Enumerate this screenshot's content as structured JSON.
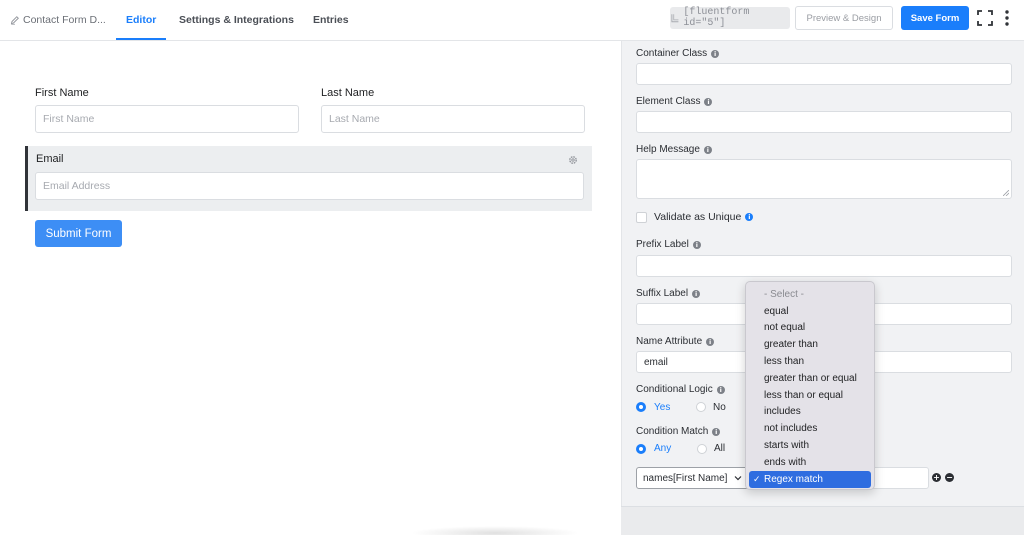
{
  "header": {
    "form_title": "Contact Form D...",
    "tabs": [
      {
        "label": "Editor",
        "active": true
      },
      {
        "label": "Settings & Integrations",
        "active": false
      },
      {
        "label": "Entries",
        "active": false
      }
    ],
    "shortcode": "[fluentform id=\"5\"]",
    "preview_label": "Preview & Design",
    "save_label": "Save Form",
    "accent_color": "#1a7efb"
  },
  "editor": {
    "first_name": {
      "label": "First Name",
      "placeholder": "First Name"
    },
    "last_name": {
      "label": "Last Name",
      "placeholder": "Last Name"
    },
    "email": {
      "label": "Email",
      "placeholder": "Email Address"
    },
    "submit_label": "Submit Form"
  },
  "settings": {
    "container_class": {
      "label": "Container Class",
      "value": ""
    },
    "element_class": {
      "label": "Element Class",
      "value": ""
    },
    "help_message": {
      "label": "Help Message",
      "value": ""
    },
    "validate_unique": {
      "label": "Validate as Unique",
      "checked": false
    },
    "prefix_label": {
      "label": "Prefix Label",
      "value": ""
    },
    "suffix_label": {
      "label": "Suffix Label",
      "value": ""
    },
    "name_attribute": {
      "label": "Name Attribute",
      "value": "email"
    },
    "conditional_logic": {
      "label": "Conditional Logic",
      "options": [
        "Yes",
        "No"
      ],
      "selected": "Yes"
    },
    "condition_match": {
      "label": "Condition Match",
      "options": [
        "Any",
        "All"
      ],
      "selected": "Any"
    },
    "condition_field": "names[First Name]",
    "info_glyph": "i"
  },
  "operator_dropdown": {
    "options": [
      "- Select -",
      "equal",
      "not equal",
      "greater than",
      "less than",
      "greater than or equal",
      "less than or equal",
      "includes",
      "not includes",
      "starts with",
      "ends with",
      "Regex match"
    ],
    "selected": "Regex match",
    "check_glyph": "✓"
  },
  "condition_buttons": {
    "add": "+",
    "remove": "−"
  }
}
